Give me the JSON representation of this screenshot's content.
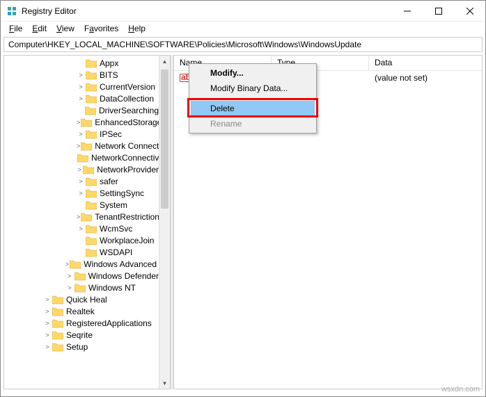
{
  "window": {
    "title": "Registry Editor"
  },
  "menu": {
    "file": "File",
    "edit": "Edit",
    "view": "View",
    "favorites": "Favorites",
    "help": "Help"
  },
  "address": "Computer\\HKEY_LOCAL_MACHINE\\SOFTWARE\\Policies\\Microsoft\\Windows\\WindowsUpdate",
  "columns": {
    "name": "Name",
    "type": "Type",
    "data": "Data"
  },
  "row": {
    "name": "",
    "type": "",
    "data": "(value not set)"
  },
  "context": {
    "modify": "Modify...",
    "modify_binary": "Modify Binary Data...",
    "delete": "Delete",
    "rename": "Rename"
  },
  "tree": [
    {
      "indent": 104,
      "exp": "",
      "label": "Appx"
    },
    {
      "indent": 104,
      "exp": ">",
      "label": "BITS"
    },
    {
      "indent": 104,
      "exp": ">",
      "label": "CurrentVersion"
    },
    {
      "indent": 104,
      "exp": ">",
      "label": "DataCollection"
    },
    {
      "indent": 104,
      "exp": "",
      "label": "DriverSearching"
    },
    {
      "indent": 104,
      "exp": ">",
      "label": "EnhancedStorageDevices"
    },
    {
      "indent": 104,
      "exp": ">",
      "label": "IPSec"
    },
    {
      "indent": 104,
      "exp": ">",
      "label": "Network Connections"
    },
    {
      "indent": 104,
      "exp": "",
      "label": "NetworkConnectivityStatusIndicator"
    },
    {
      "indent": 104,
      "exp": ">",
      "label": "NetworkProvider"
    },
    {
      "indent": 104,
      "exp": ">",
      "label": "safer"
    },
    {
      "indent": 104,
      "exp": ">",
      "label": "SettingSync"
    },
    {
      "indent": 104,
      "exp": "",
      "label": "System"
    },
    {
      "indent": 104,
      "exp": ">",
      "label": "TenantRestrictions"
    },
    {
      "indent": 104,
      "exp": ">",
      "label": "WcmSvc"
    },
    {
      "indent": 104,
      "exp": "",
      "label": "WorkplaceJoin"
    },
    {
      "indent": 104,
      "exp": "",
      "label": "WSDAPI"
    },
    {
      "indent": 88,
      "exp": ">",
      "label": "Windows Advanced Threat Protection"
    },
    {
      "indent": 88,
      "exp": ">",
      "label": "Windows Defender"
    },
    {
      "indent": 88,
      "exp": ">",
      "label": "Windows NT"
    },
    {
      "indent": 56,
      "exp": ">",
      "label": "Quick Heal"
    },
    {
      "indent": 56,
      "exp": ">",
      "label": "Realtek"
    },
    {
      "indent": 56,
      "exp": ">",
      "label": "RegisteredApplications"
    },
    {
      "indent": 56,
      "exp": ">",
      "label": "Seqrite"
    },
    {
      "indent": 56,
      "exp": ">",
      "label": "Setup"
    }
  ],
  "watermark": "wsxdn.com"
}
